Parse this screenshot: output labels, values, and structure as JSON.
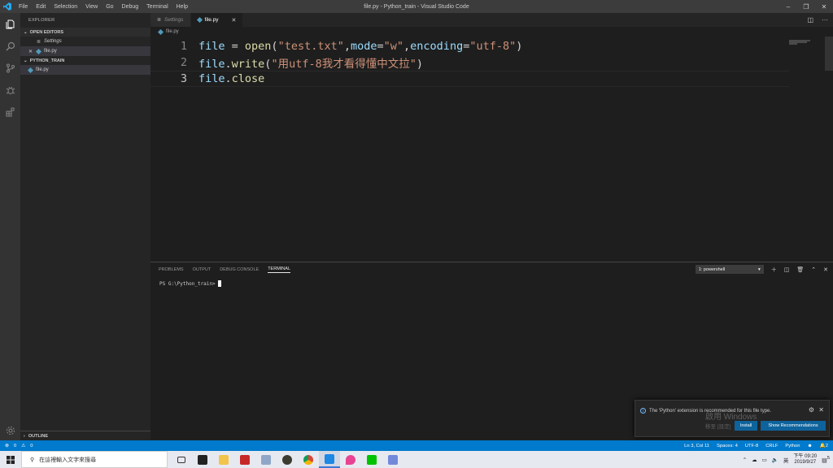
{
  "titlebar": {
    "menu": [
      "File",
      "Edit",
      "Selection",
      "View",
      "Go",
      "Debug",
      "Terminal",
      "Help"
    ],
    "title": "file.py - Python_train - Visual Studio Code"
  },
  "sidebar": {
    "header": "EXPLORER",
    "open_editors": "OPEN EDITORS",
    "open_items": [
      "Settings",
      "file.py"
    ],
    "folder": "PYTHON_TRAIN",
    "files": [
      "file.py"
    ],
    "outline": "OUTLINE"
  },
  "tabs": [
    {
      "label": "Settings",
      "active": false
    },
    {
      "label": "file.py",
      "active": true
    }
  ],
  "breadcrumb": "file.py",
  "code": {
    "line_numbers": [
      "1",
      "2",
      "3"
    ],
    "lines": [
      [
        "file",
        " = ",
        "open",
        "(",
        "\"test.txt\"",
        ",",
        "mode",
        "=",
        "\"w\"",
        ",",
        "encoding",
        "=",
        "\"utf-8\"",
        ")"
      ],
      [
        "file",
        ".",
        "write",
        "(",
        "\"用utf-8我才看得懂中文拉\"",
        ")"
      ],
      [
        "file",
        ".",
        "close"
      ]
    ]
  },
  "panel": {
    "tabs": [
      "PROBLEMS",
      "OUTPUT",
      "DEBUG CONSOLE",
      "TERMINAL"
    ],
    "active_tab": "TERMINAL",
    "shell_select": "1: powershell",
    "prompt": "PS G:\\Python_train>"
  },
  "notification": {
    "message": "The 'Python' extension is recommended for this file type.",
    "install": "Install",
    "show": "Show Recommendations",
    "watermark_title": "啟用 Windows",
    "watermark_sub": "移至 [設定]"
  },
  "statusbar": {
    "errors": "0",
    "warnings": "0",
    "position": "Ln 3, Col 11",
    "spaces": "Spaces: 4",
    "encoding": "UTF-8",
    "eol": "CRLF",
    "language": "Python",
    "bell": "2"
  },
  "taskbar": {
    "search_placeholder": "在這裡輸入文字來搜尋",
    "time_period": "下午",
    "time": "09:20",
    "date": "2019/9/27",
    "ime": "英",
    "notifications": "5"
  },
  "colors": {
    "accent": "#007acc",
    "editor_bg": "#1e1e1e",
    "sidebar_bg": "#252526",
    "button": "#0e639c"
  }
}
